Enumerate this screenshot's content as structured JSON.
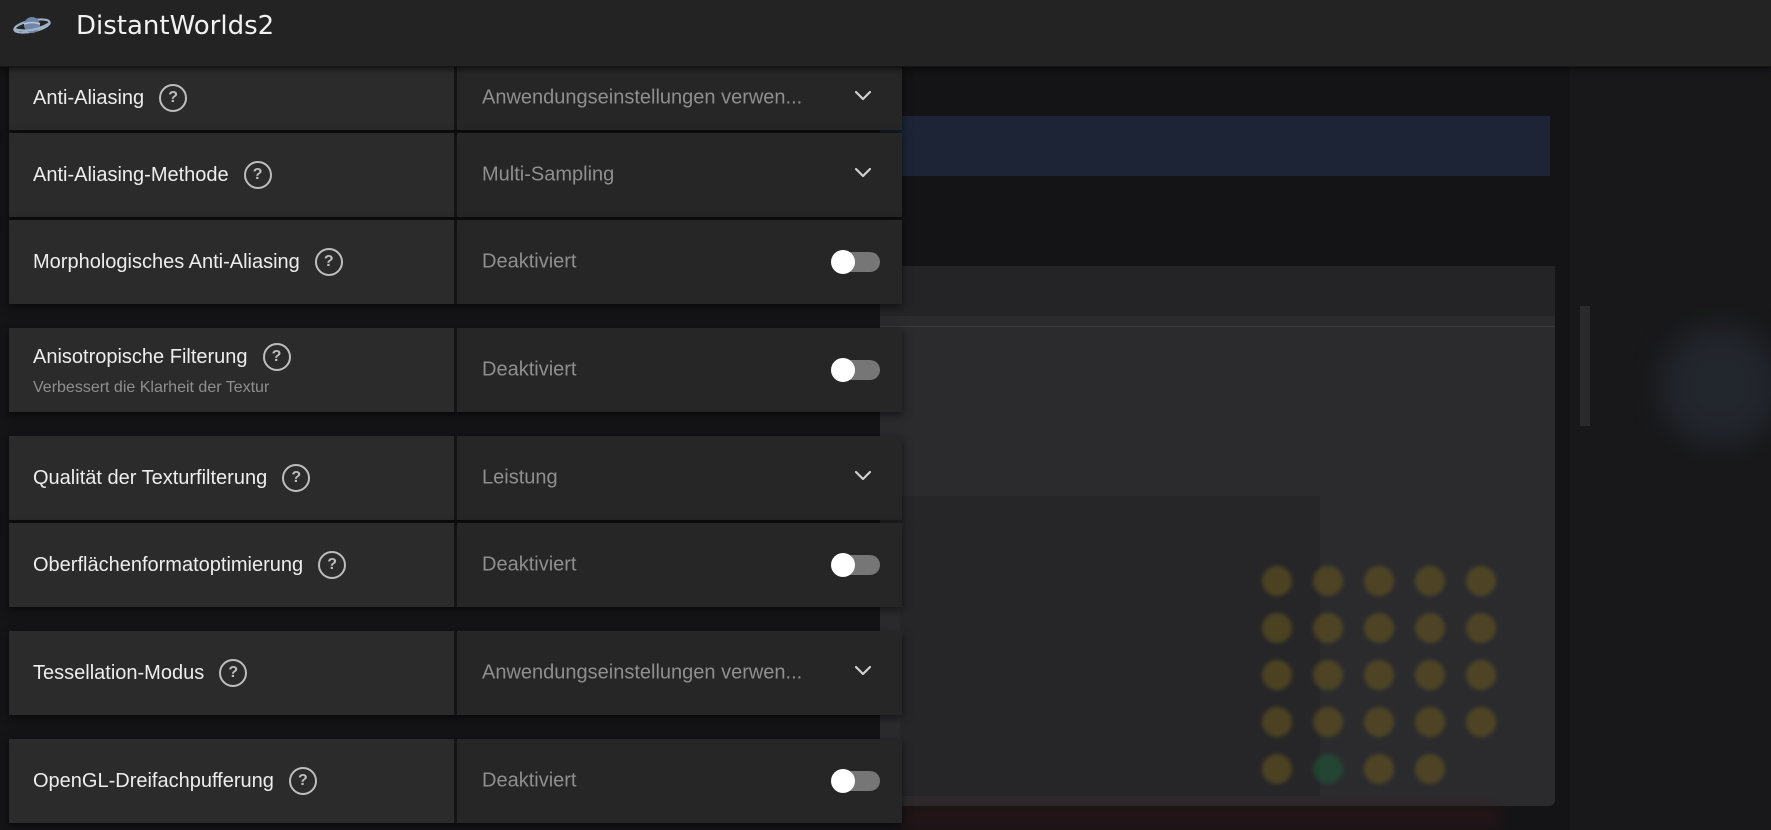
{
  "app": {
    "title": "DistantWorlds2",
    "icon": "planet-icon"
  },
  "settings": [
    {
      "id": "anti-aliasing",
      "label": "Anti-Aliasing",
      "sublabel": "",
      "value": "Anwendungseinstellungen verwen...",
      "control": "dropdown"
    },
    {
      "id": "anti-aliasing-methode",
      "label": "Anti-Aliasing-Methode",
      "sublabel": "",
      "value": "Multi-Sampling",
      "control": "dropdown"
    },
    {
      "id": "morphologisches-anti-aliasing",
      "label": "Morphologisches Anti-Aliasing",
      "sublabel": "",
      "value": "Deaktiviert",
      "control": "toggle",
      "enabled": false
    },
    {
      "id": "anisotropische-filterung",
      "label": "Anisotropische Filterung",
      "sublabel": "Verbessert die Klarheit der Textur",
      "value": "Deaktiviert",
      "control": "toggle",
      "enabled": false
    },
    {
      "id": "texturfilterung-qualitaet",
      "label": "Qualität der Texturfilterung",
      "sublabel": "",
      "value": "Leistung",
      "control": "dropdown"
    },
    {
      "id": "oberflaechenformatoptimierung",
      "label": "Oberflächenformatoptimierung",
      "sublabel": "",
      "value": "Deaktiviert",
      "control": "toggle",
      "enabled": false
    },
    {
      "id": "tessellation-modus",
      "label": "Tessellation-Modus",
      "sublabel": "",
      "value": "Anwendungseinstellungen verwen...",
      "control": "dropdown"
    },
    {
      "id": "opengl-dreifachpufferung",
      "label": "OpenGL-Dreifachpufferung",
      "sublabel": "",
      "value": "Deaktiviert",
      "control": "toggle",
      "enabled": false
    }
  ],
  "icons": {
    "help": "help-circle-icon",
    "dropdown": "chevron-down-icon"
  },
  "help_glyph": "?",
  "colors": {
    "titlebar": "#232323",
    "row_label_bg": "#2b2b2b",
    "row_value_bg": "#262626",
    "toggle_off": "#767676"
  }
}
